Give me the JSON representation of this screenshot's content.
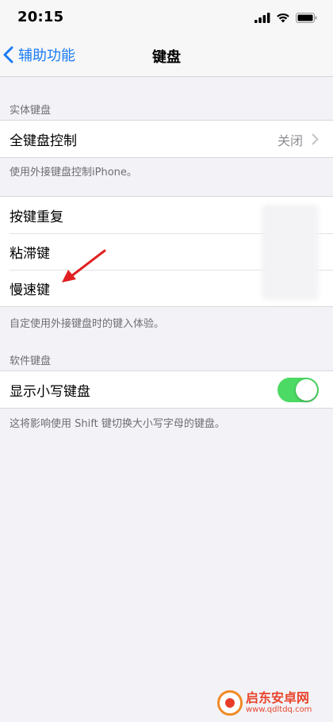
{
  "status_bar": {
    "time": "20:15"
  },
  "nav": {
    "back_label": "辅助功能",
    "title": "键盘"
  },
  "physical_keyboard": {
    "header": "实体键盘",
    "full_keyboard_access": {
      "label": "全键盘控制",
      "value": "关闭"
    },
    "footer": "使用外接键盘控制iPhone。"
  },
  "key_options": {
    "items": [
      {
        "label": "按键重复"
      },
      {
        "label": "粘滞键"
      },
      {
        "label": "慢速键"
      }
    ],
    "footer": "自定使用外接键盘时的键入体验。"
  },
  "software_keyboard": {
    "header": "软件键盘",
    "show_lowercase": {
      "label": "显示小写键盘",
      "on": true
    },
    "footer": "这将影响使用 Shift 键切换大小写字母的键盘。"
  },
  "watermark": {
    "main": "启东安卓网",
    "url": "www.qdltdq.com"
  },
  "colors": {
    "accent": "#1a7cf5",
    "toggle_on": "#4cd964",
    "arrow": "#e02020",
    "background": "#f2f2f7"
  }
}
